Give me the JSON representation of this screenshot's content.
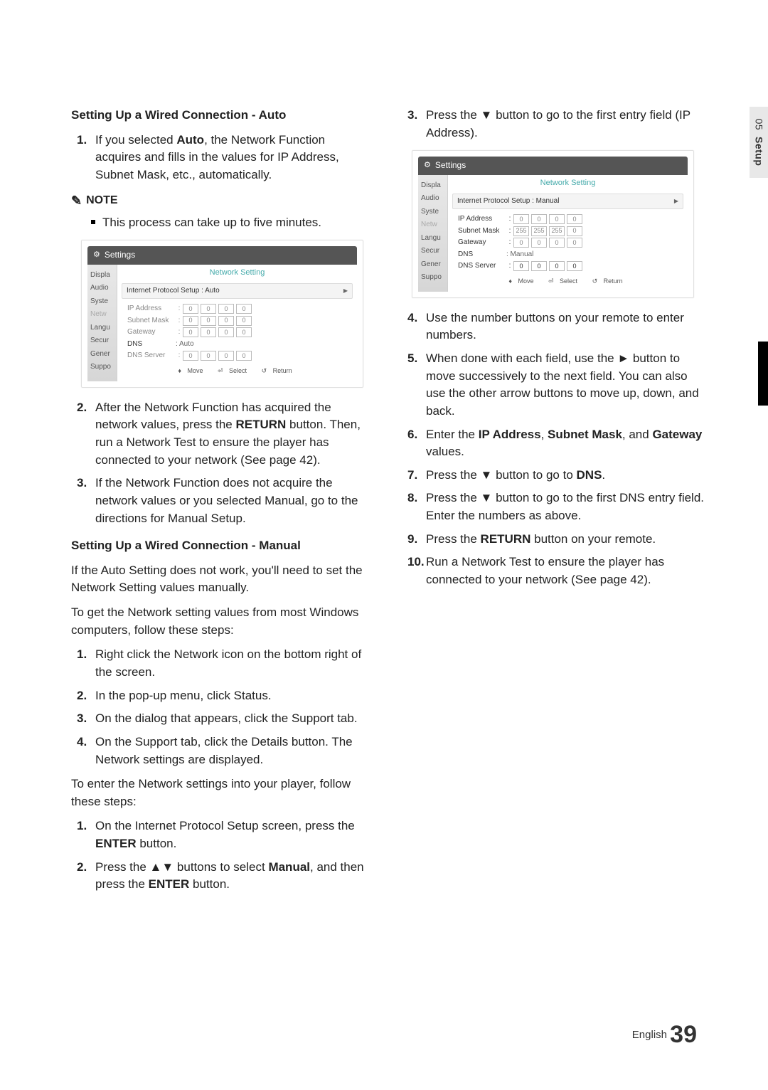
{
  "sidetab": {
    "chapter": "05",
    "label": "Setup"
  },
  "left": {
    "h1": "Setting Up a Wired Connection - Auto",
    "step1": {
      "num": "1.",
      "text_a": "If you selected ",
      "bold1": "Auto",
      "text_b": ", the Network Function acquires and fills in the values for IP Address, Subnet Mask, etc., automatically."
    },
    "note_label": "NOTE",
    "note_line": "This process can take up to five minutes.",
    "shot_auto": {
      "title": "Settings",
      "header": "Network Setting",
      "sidebar": [
        "Displa",
        "Audio",
        "Syste",
        "Netw",
        "Langu",
        "Secur",
        "Gener",
        "Suppo"
      ],
      "proto_label": "Internet Protocol Setup  : Auto",
      "rows": [
        {
          "label": "IP Address",
          "vals": [
            "0",
            "0",
            "0",
            "0"
          ]
        },
        {
          "label": "Subnet Mask",
          "vals": [
            "0",
            "0",
            "0",
            "0"
          ]
        },
        {
          "label": "Gateway",
          "vals": [
            "0",
            "0",
            "0",
            "0"
          ]
        }
      ],
      "dns_label": "DNS",
      "dns_mode": ": Auto",
      "dns_server": {
        "label": "DNS Server",
        "vals": [
          "0",
          "0",
          "0",
          "0"
        ]
      },
      "footer": {
        "move": "Move",
        "select": "Select",
        "return": "Return"
      }
    },
    "step2": {
      "num": "2.",
      "text_a": "After the Network Function has acquired the network values, press the ",
      "bold1": "RETURN",
      "text_b": " button. Then, run a Network Test to ensure the player has connected to your network (See page 42)."
    },
    "step3": {
      "num": "3.",
      "text": "If the Network Function does not acquire the network values or you selected Manual, go to the directions for Manual Setup."
    },
    "h2": "Setting Up a Wired Connection - Manual",
    "p1": "If the Auto Setting does not work, you'll need to set the Network Setting values manually.",
    "p2": "To get the Network setting values from most Windows computers, follow these steps:",
    "mlist": [
      {
        "num": "1.",
        "text": "Right click the Network icon on the bottom right of the screen."
      },
      {
        "num": "2.",
        "text": "In the pop-up menu, click Status."
      },
      {
        "num": "3.",
        "text": "On the dialog that appears, click the Support tab."
      },
      {
        "num": "4.",
        "text": "On the Support tab, click the Details button. The Network settings are displayed."
      }
    ],
    "p3": "To enter the Network settings into your player, follow these steps:",
    "elist": [
      {
        "num": "1.",
        "text_a": "On the Internet Protocol Setup screen, press the ",
        "bold1": "ENTER",
        "text_b": " button."
      },
      {
        "num": "2.",
        "text_a": "Press the ▲▼ buttons to select ",
        "bold1": "Manual",
        "text_b": ", and then press the ",
        "bold2": "ENTER",
        "text_c": " button."
      }
    ]
  },
  "right": {
    "step3": {
      "num": "3.",
      "text": "Press the ▼ button to go to the first entry field (IP Address)."
    },
    "shot_manual": {
      "title": "Settings",
      "header": "Network Setting",
      "sidebar": [
        "Displa",
        "Audio",
        "Syste",
        "Netw",
        "Langu",
        "Secur",
        "Gener",
        "Suppo"
      ],
      "proto_label": "Internet Protocol Setup  : Manual",
      "rows": [
        {
          "label": "IP Address",
          "vals": [
            "0",
            "0",
            "0",
            "0"
          ]
        },
        {
          "label": "Subnet Mask",
          "vals": [
            "255",
            "255",
            "255",
            "0"
          ]
        },
        {
          "label": "Gateway",
          "vals": [
            "0",
            "0",
            "0",
            "0"
          ]
        }
      ],
      "dns_label": "DNS",
      "dns_mode": ": Manual",
      "dns_server": {
        "label": "DNS Server",
        "vals": [
          "0",
          "0",
          "0",
          "0"
        ]
      },
      "footer": {
        "move": "Move",
        "select": "Select",
        "return": "Return"
      }
    },
    "steps": [
      {
        "num": "4.",
        "text": "Use the number buttons on your remote to enter numbers."
      },
      {
        "num": "5.",
        "text": "When done with each field, use the ► button to move successively to the next field. You can also use the other arrow buttons to move up, down, and back."
      },
      {
        "num": "6.",
        "text_a": "Enter the ",
        "bold1": "IP Address",
        "mid1": ", ",
        "bold2": "Subnet Mask",
        "mid2": ", and ",
        "bold3": "Gateway",
        "text_b": " values."
      },
      {
        "num": "7.",
        "text_a": "Press the ▼ button to go to ",
        "bold1": "DNS",
        "text_b": "."
      },
      {
        "num": "8.",
        "text": "Press the ▼ button to go to the first DNS entry field. Enter the numbers as above."
      },
      {
        "num": "9.",
        "text_a": "Press the ",
        "bold1": "RETURN",
        "text_b": " button on your remote."
      },
      {
        "num": "10.",
        "text": "Run a Network Test to ensure the player has connected to your network (See page 42)."
      }
    ]
  },
  "footer": {
    "lang": "English",
    "page": "39"
  }
}
